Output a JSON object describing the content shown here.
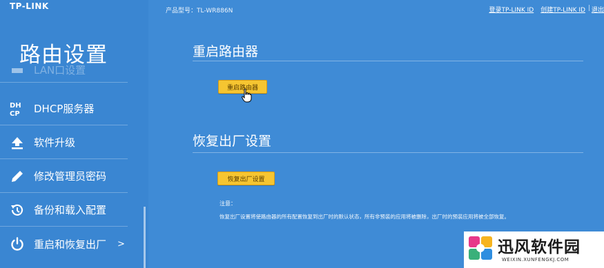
{
  "header": {
    "brand": "TP-LINK",
    "product_model": "产品型号：TL-WR886N",
    "links": [
      {
        "label": "登录TP-LINK ID"
      },
      {
        "label": "创建TP-LINK ID"
      },
      {
        "label": "退出",
        "prefix": "|"
      }
    ]
  },
  "sidebar": {
    "title": "路由设置",
    "items": [
      {
        "label": "LAN口设置",
        "icon": "lan-icon"
      },
      {
        "label": "DHCP服务器",
        "icon": "dhcp-icon"
      },
      {
        "label": "软件升级",
        "icon": "upload-icon"
      },
      {
        "label": "修改管理员密码",
        "icon": "pencil-icon"
      },
      {
        "label": "备份和载入配置",
        "icon": "history-icon"
      },
      {
        "label": "重启和恢复出厂",
        "icon": "power-icon",
        "chevron": ">"
      }
    ]
  },
  "main": {
    "reboot": {
      "title": "重启路由器",
      "button": "重启路由器"
    },
    "factory": {
      "title": "恢复出厂设置",
      "button": "恢复出厂设置",
      "note_title": "注意：",
      "note_text": "恢复出厂设置将使路由器的所有配置恢复到出厂时的默认状态，所有非预装的应用将被删除，出厂时的预装应用将被全部恢复。"
    }
  },
  "watermark": {
    "name": "迅风软件园",
    "url": "WEIXIN.XUNFENGKJ.COM"
  },
  "colors": {
    "background": "#3f8bd6",
    "sidebar": "#3a86d2",
    "button": "#f6c531",
    "button_border": "#d79b12"
  }
}
